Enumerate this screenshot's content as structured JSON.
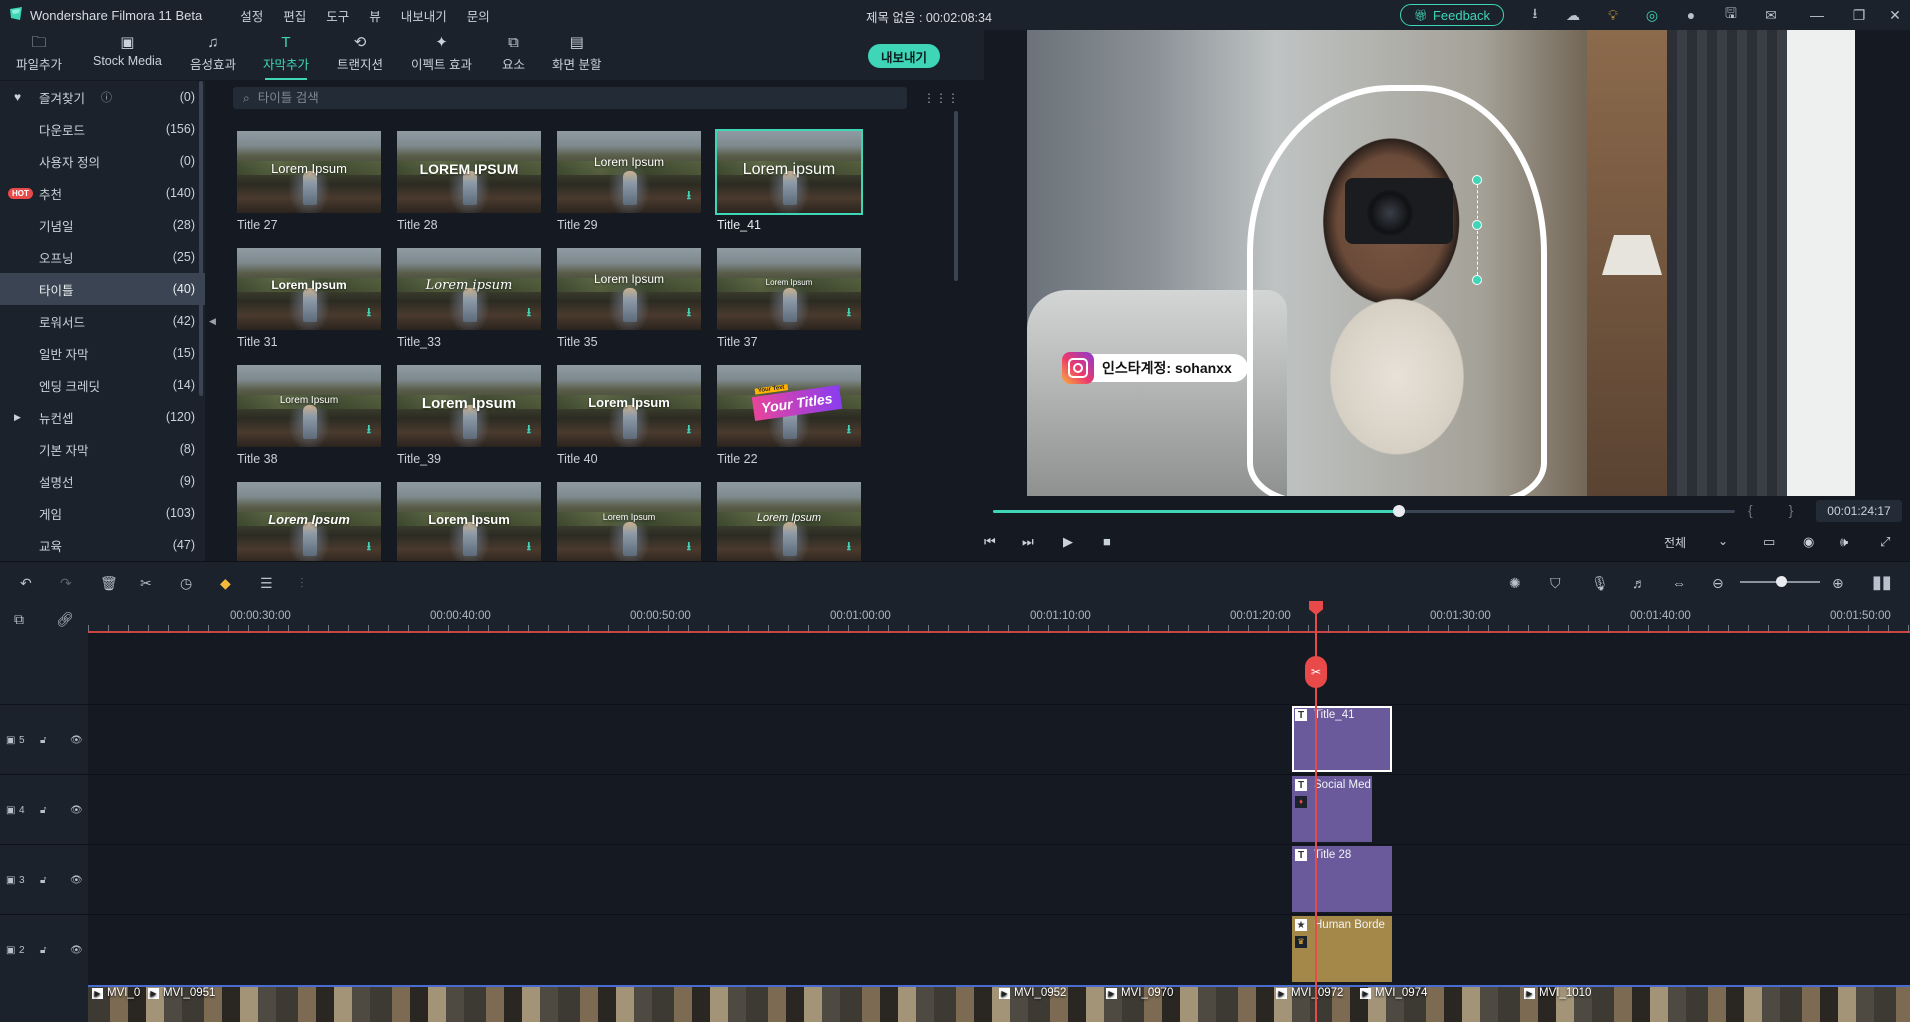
{
  "titlebar": {
    "app_title": "Wondershare Filmora 11 Beta",
    "menus": [
      "설정",
      "편집",
      "도구",
      "뷰",
      "내보내기",
      "문의"
    ],
    "doc_title": "제목 없음 : 00:02:08:34",
    "feedback_label": "Feedback"
  },
  "toolbar": {
    "tabs": [
      {
        "label": "파일추가",
        "icon": "folder-icon"
      },
      {
        "label": "Stock Media",
        "icon": "stock-media-icon"
      },
      {
        "label": "음성효과",
        "icon": "music-note-icon"
      },
      {
        "label": "자막추가",
        "icon": "text-icon"
      },
      {
        "label": "트랜지션",
        "icon": "transition-icon"
      },
      {
        "label": "이펙트 효과",
        "icon": "effects-icon"
      },
      {
        "label": "요소",
        "icon": "elements-icon"
      },
      {
        "label": "화면 분할",
        "icon": "split-screen-icon"
      }
    ],
    "active_tab": "자막추가",
    "export_label": "내보내기"
  },
  "sidebar": {
    "categories": [
      {
        "label": "즐겨찾기",
        "count": "(0)"
      },
      {
        "label": "다운로드",
        "count": "(156)"
      },
      {
        "label": "사용자 정의",
        "count": "(0)"
      },
      {
        "label": "추천",
        "count": "(140)",
        "badge": "HOT"
      },
      {
        "label": "기념일",
        "count": "(28)"
      },
      {
        "label": "오프닝",
        "count": "(25)"
      },
      {
        "label": "타이틀",
        "count": "(40)"
      },
      {
        "label": "로워서드",
        "count": "(42)"
      },
      {
        "label": "일반 자막",
        "count": "(15)"
      },
      {
        "label": "엔딩 크레딧",
        "count": "(14)"
      },
      {
        "label": "뉴컨셉",
        "count": "(120)"
      },
      {
        "label": "기본 자막",
        "count": "(8)"
      },
      {
        "label": "설명선",
        "count": "(9)"
      },
      {
        "label": "게임",
        "count": "(103)"
      },
      {
        "label": "교육",
        "count": "(47)"
      }
    ],
    "selected": "타이틀"
  },
  "search": {
    "placeholder": "타이틀 검색"
  },
  "templates": [
    {
      "name": "Title 27",
      "overlay": "Lorem Ipsum",
      "download": false
    },
    {
      "name": "Title 28",
      "overlay": "LOREM IPSUM",
      "download": false
    },
    {
      "name": "Title 29",
      "overlay": "Lorem Ipsum",
      "download": true
    },
    {
      "name": "Title_41",
      "overlay": "Lorem ipsum",
      "download": false,
      "selected": true
    },
    {
      "name": "Title 31",
      "overlay": "Lorem Ipsum",
      "download": true
    },
    {
      "name": "Title_33",
      "overlay": "Lorem ipsum",
      "download": true
    },
    {
      "name": "Title 35",
      "overlay": "Lorem Ipsum",
      "download": true
    },
    {
      "name": "Title 37",
      "overlay": "Lorem Ipsum",
      "download": true
    },
    {
      "name": "Title 38",
      "overlay": "Lorem Ipsum",
      "download": true
    },
    {
      "name": "Title_39",
      "overlay": "Lorem Ipsum",
      "download": true
    },
    {
      "name": "Title 40",
      "overlay": "Lorem Ipsum",
      "download": true
    },
    {
      "name": "Title 22",
      "overlay": "Your Titles",
      "overlay_small": "Your Text",
      "download": true
    },
    {
      "name": "",
      "overlay": "Lorem Ipsum",
      "download": true
    },
    {
      "name": "",
      "overlay": "Lorem Ipsum",
      "download": true
    },
    {
      "name": "",
      "overlay": "Lorem Ipsum",
      "download": true
    },
    {
      "name": "",
      "overlay": "Lorem Ipsum",
      "download": true
    }
  ],
  "preview": {
    "instagram_text": "인스타계정: sohanxx",
    "progress_fraction": 0.547,
    "timecode": "00:01:24:17",
    "quality": "전체"
  },
  "timeline": {
    "ruler_labels": [
      "00:00:30:00",
      "00:00:40:00",
      "00:00:50:00",
      "00:01:00:00",
      "00:01:10:00",
      "00:01:20:00",
      "00:01:30:00",
      "00:01:40:00",
      "00:01:50:00"
    ],
    "tracks": [
      {
        "number": "5",
        "clip": "Title_41",
        "icon": "T"
      },
      {
        "number": "4",
        "clip": "Social Med",
        "icon": "T"
      },
      {
        "number": "3",
        "clip": "Title 28",
        "icon": "T"
      },
      {
        "number": "2",
        "clip": "Human Borde",
        "icon": "★"
      }
    ],
    "video_clips": [
      "MVI_0",
      "MVI_0951",
      "MVI_0952",
      "MVI_0970",
      "MVI_0972",
      "MVI_0974",
      "MVI_1010"
    ]
  },
  "colors": {
    "accent": "#3fd6b7",
    "playhead": "#e84a4a",
    "title_clip": "#6a5a9c",
    "effect_clip": "#a3884a"
  }
}
